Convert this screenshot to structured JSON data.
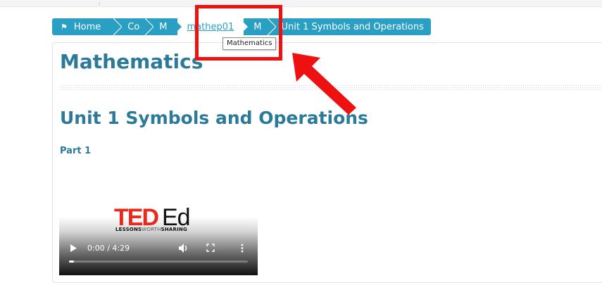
{
  "breadcrumb": {
    "home_label": "Home",
    "items": [
      "Co",
      "M",
      "mathep01",
      "M",
      "Unit 1 Symbols and Operations"
    ],
    "color": "#2a9fc4"
  },
  "tooltip": {
    "text": "Mathematics"
  },
  "content": {
    "title": "Mathematics",
    "unit_title": "Unit 1 Symbols and Operations",
    "part_label": "Part 1",
    "heading_color": "#2b7a99"
  },
  "video": {
    "logo_text": "TED Ed",
    "tagline_bold_1": "LESSONS",
    "tagline_thin": "WORTH",
    "tagline_bold_2": "SHARING",
    "time_display": "0:00 / 4:29",
    "progress": 0.0
  },
  "annotation": {
    "color": "#ee1111",
    "icons": [
      "highlight-box",
      "pointer-arrow"
    ]
  }
}
